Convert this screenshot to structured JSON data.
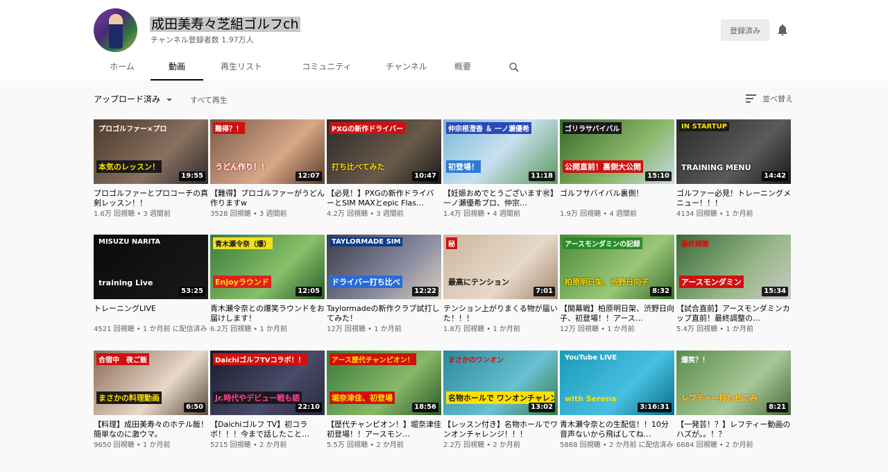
{
  "channel": {
    "name": "成田美寿々芝組ゴルフch",
    "subscribers": "チャンネル登録者数 1.97万人",
    "subscribed_label": "登録済み",
    "bell_icon": "bell-icon"
  },
  "tabs": [
    "ホーム",
    "動画",
    "再生リスト",
    "コミュニティ",
    "チャンネル",
    "概要"
  ],
  "filter": {
    "label": "アップロード済み",
    "play_all": "すべて再生",
    "sort": "並べ替え"
  },
  "videos": [
    {
      "title": "プロゴルファーとプロコーチの真剣レッスン！！",
      "views": "1.6万 回視聴",
      "age": "3 週間前",
      "duration": "19:55",
      "caption": "本気のレッスン！",
      "caption2": "プロゴルファー×プロ"
    },
    {
      "title": "【難得】プロゴルファーがうどん作りますw",
      "views": "3528 回視聴",
      "age": "3 週間前",
      "duration": "12:07",
      "caption": "うどん作り！！",
      "caption2": "難得？！"
    },
    {
      "title": "【必見！】PXGの新作ドライバーとSIM MAXとepic Flas…",
      "views": "4.2万 回視聴",
      "age": "3 週間前",
      "duration": "10:47",
      "caption": "打ち比べてみた",
      "caption2": "PXGの新作ドライバー"
    },
    {
      "title": "【妊娠おめでとうございます㊗】一ノ瀬優希プロ、仲宗…",
      "views": "1.4万 回視聴",
      "age": "4 週間前",
      "duration": "11:18",
      "caption": "初登場！",
      "caption2": "仲宗根澄香 ＆ 一ノ瀬優希"
    },
    {
      "title": "ゴルフサバイバル裏側！",
      "views": "1.9万 回視聴",
      "age": "4 週間前",
      "duration": "15:10",
      "caption": "公開直前！裏側大公開",
      "caption2": "ゴリラサバイバル"
    },
    {
      "title": "ゴルファー必見！トレーニングメニュー！！！",
      "views": "4134 回視聴",
      "age": "1 か月前",
      "duration": "14:42",
      "caption": "TRAINING MENU",
      "caption2": "IN STARTUP"
    },
    {
      "title": "トレーニングLIVE",
      "views": "4521 回視聴",
      "age": "1 か月前 に配信済み",
      "duration": "53:25",
      "caption": "training Live",
      "caption2": "MISUZU NARITA"
    },
    {
      "title": "青木瀬令奈との爆笑ラウンドをお届けします！",
      "views": "6.2万 回視聴",
      "age": "1 か月前",
      "duration": "12:05",
      "caption": "Enjoyラウンド",
      "caption2": "青木瀬令奈（爆）"
    },
    {
      "title": "Taylormadeの新作クラブ試打してみた！",
      "views": "12万 回視聴",
      "age": "1 か月前",
      "duration": "12:22",
      "caption": "ドライバー打ち比べ",
      "caption2": "TAYLORMADE SIM"
    },
    {
      "title": "テンション上がりまくる物が届いた！！！",
      "views": "1.8万 回視聴",
      "age": "1 か月前",
      "duration": "7:01",
      "caption": "最高にテンション",
      "caption2": "秘"
    },
    {
      "title": "【開幕戦】柏原明日架、渋野日向子、初登場！！アース…",
      "views": "12万 回視聴",
      "age": "1 か月前",
      "duration": "8:32",
      "caption": "柏原明日架、渋野日向子",
      "caption2": "アースモンダミンの記録"
    },
    {
      "title": "【試合直前】アースモンダミンカップ直前！最終調整の…",
      "views": "5.4万 回視聴",
      "age": "1 か月前",
      "duration": "15:34",
      "caption": "アースモンダミン",
      "caption2": "最終調整"
    },
    {
      "title": "【料理】成田美寿々のホテル飯！簡単なのに激ウマ。",
      "views": "9650 回視聴",
      "age": "1 か月前",
      "duration": "6:50",
      "caption": "まさかの料理動画",
      "caption2": "合宿中　夜ご飯"
    },
    {
      "title": "【Daichiゴルフ TV】初コラボ！！！今まで話したこと…",
      "views": "5215 回視聴",
      "age": "2 か月前",
      "duration": "22:10",
      "caption": "Jr.時代やデビュー戦も語",
      "caption2": "DaichiゴルフTVコラボ！！"
    },
    {
      "title": "【歴代チャンピオン！】堀奈津佳初登場！！アースモン…",
      "views": "5.5万 回視聴",
      "age": "2 か月前",
      "duration": "18:56",
      "caption": "堀奈津佳、初登場",
      "caption2": "アース歴代チャンピオン！"
    },
    {
      "title": "【レッスン付き】名物ホールでワンオンチャレンジ！！！",
      "views": "2.2万 回視聴",
      "age": "2 か月前",
      "duration": "13:02",
      "caption": "名物ホールで ワンオンチャレンジ",
      "caption2": "まさかのワンオン"
    },
    {
      "title": "青木瀬令奈との生配信！！10分音声ないから飛ばしてね…",
      "views": "5868 回視聴",
      "age": "2 か月前 に配信済み",
      "duration": "3:16:31",
      "caption": "with Serena",
      "caption2": "YouTube LIVE"
    },
    {
      "title": "【一発芸！？】レフティー動画のハズが。。！？",
      "views": "6684 回視聴",
      "age": "2 か月前",
      "duration": "8:21",
      "caption": "レフティー打たせてみ",
      "caption2": "爆笑？！"
    }
  ]
}
